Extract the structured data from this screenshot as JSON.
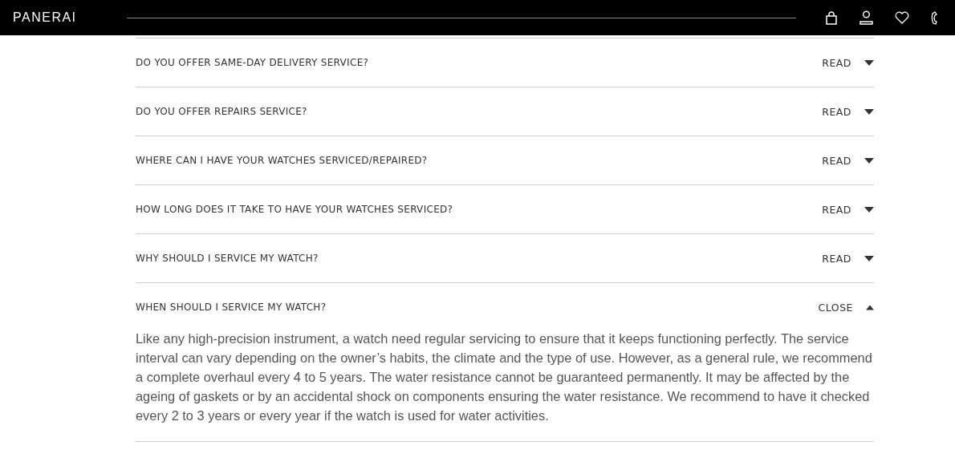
{
  "header": {
    "logo": "PANERAI"
  },
  "faq": [
    {
      "question": "DO YOU OFFER SAME-DAY DELIVERY SERVICE?",
      "toggle": "READ",
      "expanded": false
    },
    {
      "question": "DO YOU OFFER REPAIRS SERVICE?",
      "toggle": "READ",
      "expanded": false
    },
    {
      "question": "WHERE CAN I HAVE YOUR WATCHES SERVICED/REPAIRED?",
      "toggle": "READ",
      "expanded": false
    },
    {
      "question": "HOW LONG DOES IT TAKE TO HAVE YOUR WATCHES SERVICED?",
      "toggle": "READ",
      "expanded": false
    },
    {
      "question": "WHY SHOULD I SERVICE MY WATCH?",
      "toggle": "READ",
      "expanded": false
    },
    {
      "question": "WHEN SHOULD I SERVICE MY WATCH?",
      "toggle": "CLOSE",
      "expanded": true,
      "answer": "Like any high-precision instrument, a watch need regular servicing to ensure that it keeps functioning perfectly. The service interval can vary depending on the owner’s habits, the climate and the type of use. However, as a general rule, we recommend a complete overhaul every 4 to 5 years. The water resistance cannot be guaranteed permanently. It may be affected by the ageing of gaskets or by an accidental shock on components ensuring the water resistance. We recommend to have it checked every 2 to 3 years or every year if the watch is used for water activities."
    }
  ]
}
